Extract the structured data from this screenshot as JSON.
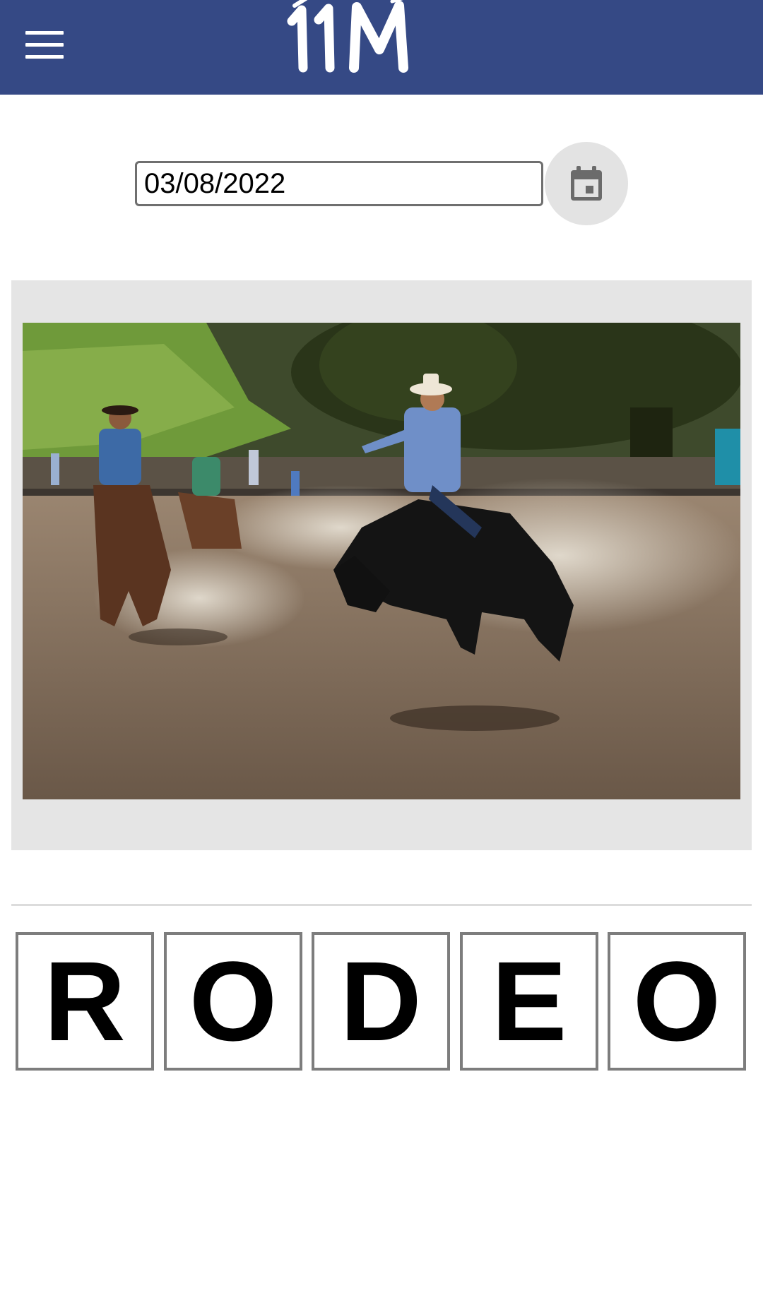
{
  "header": {
    "logo_text": "11M",
    "menu_icon": "hamburger-menu-icon",
    "background_color": "#354985"
  },
  "date_picker": {
    "value": "03/08/2022",
    "calendar_icon": "calendar-icon"
  },
  "puzzle": {
    "letters": [
      "R",
      "O",
      "D",
      "E",
      "O"
    ]
  }
}
